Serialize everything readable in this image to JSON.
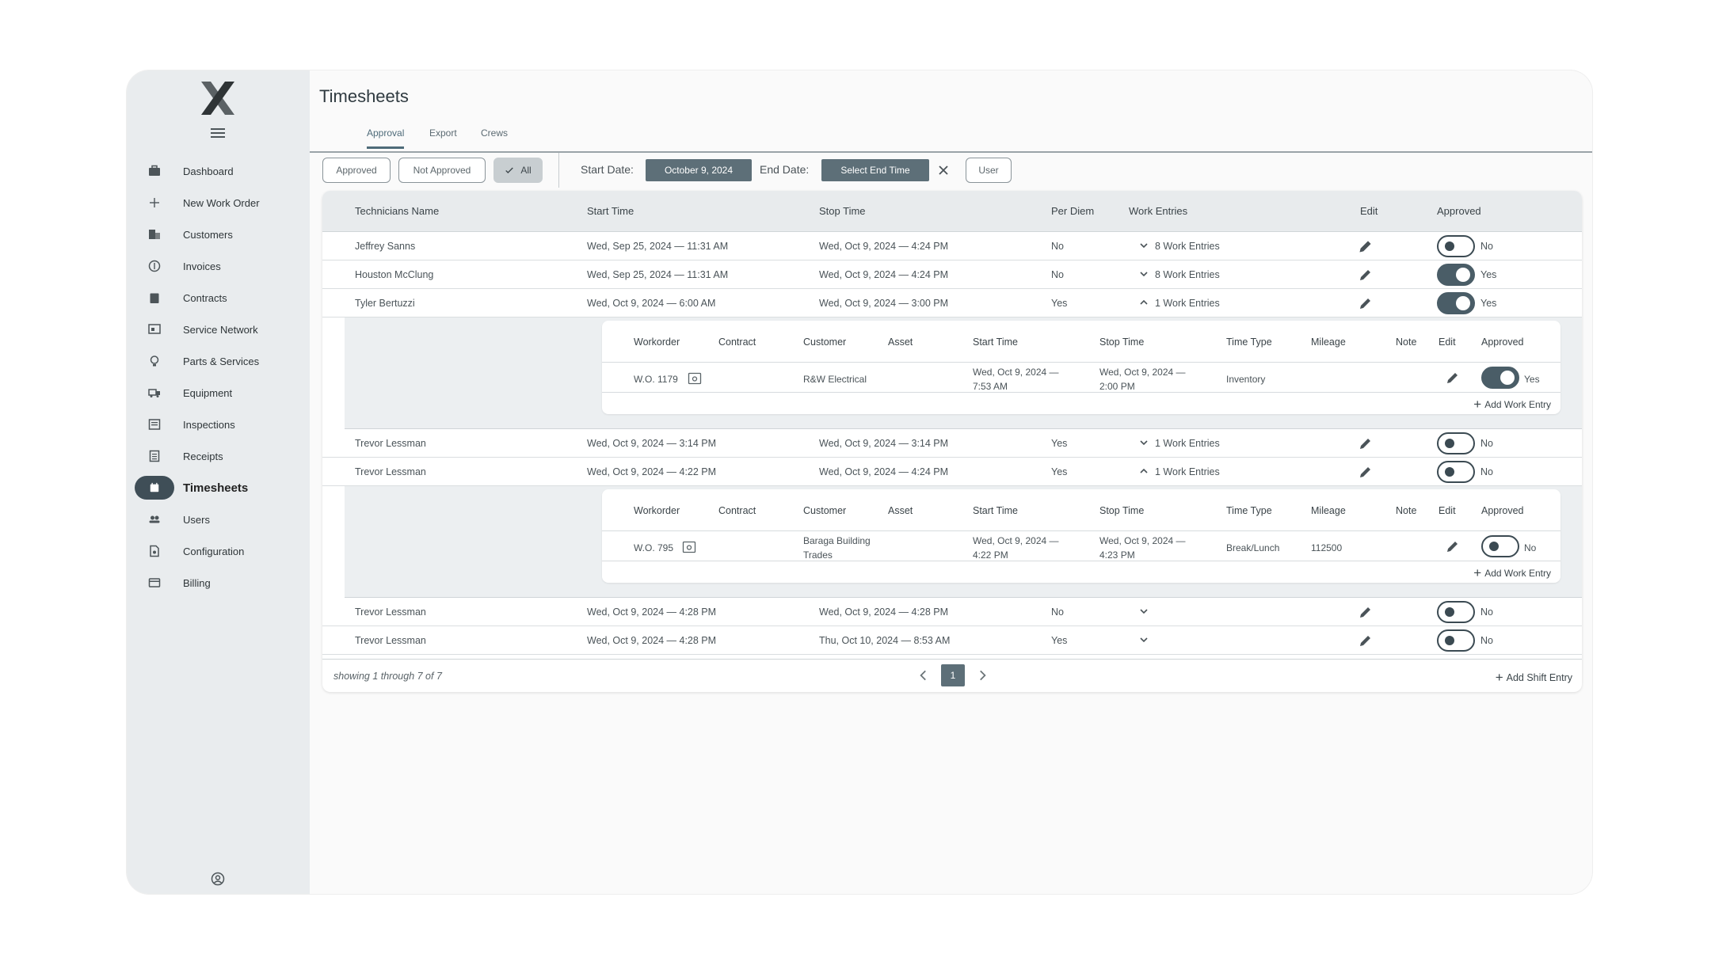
{
  "app": {
    "logo": "X"
  },
  "sidebar": {
    "items": [
      {
        "label": "Dashboard",
        "icon": "briefcase-icon"
      },
      {
        "label": "New Work Order",
        "icon": "plus-icon"
      },
      {
        "label": "Customers",
        "icon": "building-icon"
      },
      {
        "label": "Invoices",
        "icon": "dollar-icon"
      },
      {
        "label": "Contracts",
        "icon": "clipboard-icon"
      },
      {
        "label": "Service Network",
        "icon": "network-icon"
      },
      {
        "label": "Parts & Services",
        "icon": "bulb-icon"
      },
      {
        "label": "Equipment",
        "icon": "truck-icon"
      },
      {
        "label": "Inspections",
        "icon": "checklist-icon"
      },
      {
        "label": "Receipts",
        "icon": "receipt-icon"
      },
      {
        "label": "Timesheets",
        "icon": "calendar-icon"
      },
      {
        "label": "Users",
        "icon": "users-icon"
      },
      {
        "label": "Configuration",
        "icon": "file-settings-icon"
      },
      {
        "label": "Billing",
        "icon": "card-icon"
      }
    ]
  },
  "page": {
    "title": "Timesheets",
    "tabs": [
      "Approval",
      "Export",
      "Crews"
    ]
  },
  "filters": {
    "approved": "Approved",
    "not_approved": "Not Approved",
    "all": "All",
    "start_label": "Start Date:",
    "start_value": "October 9, 2024",
    "end_label": "End Date:",
    "end_value": "Select End Time",
    "user": "User"
  },
  "table": {
    "headers": [
      "Technicians Name",
      "Start Time",
      "Stop Time",
      "Per Diem",
      "Work Entries",
      "Edit",
      "Approved"
    ],
    "rows": [
      {
        "name": "Jeffrey Sanns",
        "start": "Wed, Sep 25, 2024 — 11:31 AM",
        "stop": "Wed, Oct 9, 2024 — 4:24 PM",
        "per_diem": "No",
        "entries": "8 Work Entries",
        "approved": "No"
      },
      {
        "name": "Houston McClung",
        "start": "Wed, Sep 25, 2024 — 11:31 AM",
        "stop": "Wed, Oct 9, 2024 — 4:24 PM",
        "per_diem": "No",
        "entries": "8 Work Entries",
        "approved": "Yes"
      },
      {
        "name": "Tyler Bertuzzi",
        "start": "Wed, Oct 9, 2024 — 6:00 AM",
        "stop": "Wed, Oct 9, 2024 — 3:00 PM",
        "per_diem": "Yes",
        "entries": "1 Work Entries",
        "approved": "Yes"
      },
      {
        "name": "Trevor Lessman",
        "start": "Wed, Oct 9, 2024 — 3:14 PM",
        "stop": "Wed, Oct 9, 2024 — 3:14 PM",
        "per_diem": "Yes",
        "entries": "1 Work Entries",
        "approved": "No"
      },
      {
        "name": "Trevor Lessman",
        "start": "Wed, Oct 9, 2024 — 4:22 PM",
        "stop": "Wed, Oct 9, 2024 — 4:24 PM",
        "per_diem": "Yes",
        "entries": "1 Work Entries",
        "approved": "No"
      },
      {
        "name": "Trevor Lessman",
        "start": "Wed, Oct 9, 2024 — 4:28 PM",
        "stop": "Wed, Oct 9, 2024 — 4:28 PM",
        "per_diem": "No",
        "entries": "",
        "approved": "No"
      },
      {
        "name": "Trevor Lessman",
        "start": "Wed, Oct 9, 2024 — 4:28 PM",
        "stop": "Thu, Oct 10, 2024 — 8:53 AM",
        "per_diem": "Yes",
        "entries": "",
        "approved": "No"
      }
    ],
    "sub_headers": [
      "Workorder",
      "Contract",
      "Customer",
      "Asset",
      "Start Time",
      "Stop Time",
      "Time Type",
      "Mileage",
      "Note",
      "Edit",
      "Approved"
    ],
    "sub1": {
      "workorder": "W.O. 1179",
      "contract": "",
      "customer": "R&W Electrical",
      "asset": "",
      "start": "Wed, Oct 9, 2024 — 7:53 AM",
      "stop": "Wed, Oct 9, 2024 — 2:00 PM",
      "time_type": "Inventory",
      "mileage": "",
      "note": "",
      "approved": "Yes",
      "add": "Add Work Entry"
    },
    "sub2": {
      "workorder": "W.O. 795",
      "contract": "",
      "customer": "Baraga Building Trades",
      "asset": "",
      "start": "Wed, Oct 9, 2024 — 4:22 PM",
      "stop": "Wed, Oct 9, 2024 — 4:23 PM",
      "time_type": "Break/Lunch",
      "mileage": "112500",
      "note": "",
      "approved": "No",
      "add": "Add Work Entry"
    },
    "footer": {
      "showing": "showing 1 through 7 of 7",
      "page": "1",
      "add_shift": "Add Shift Entry"
    }
  },
  "colors": {
    "accent": "#5d6f78",
    "sidebar_bg": "#e9ecee",
    "active_nav": "#3f4e57"
  }
}
